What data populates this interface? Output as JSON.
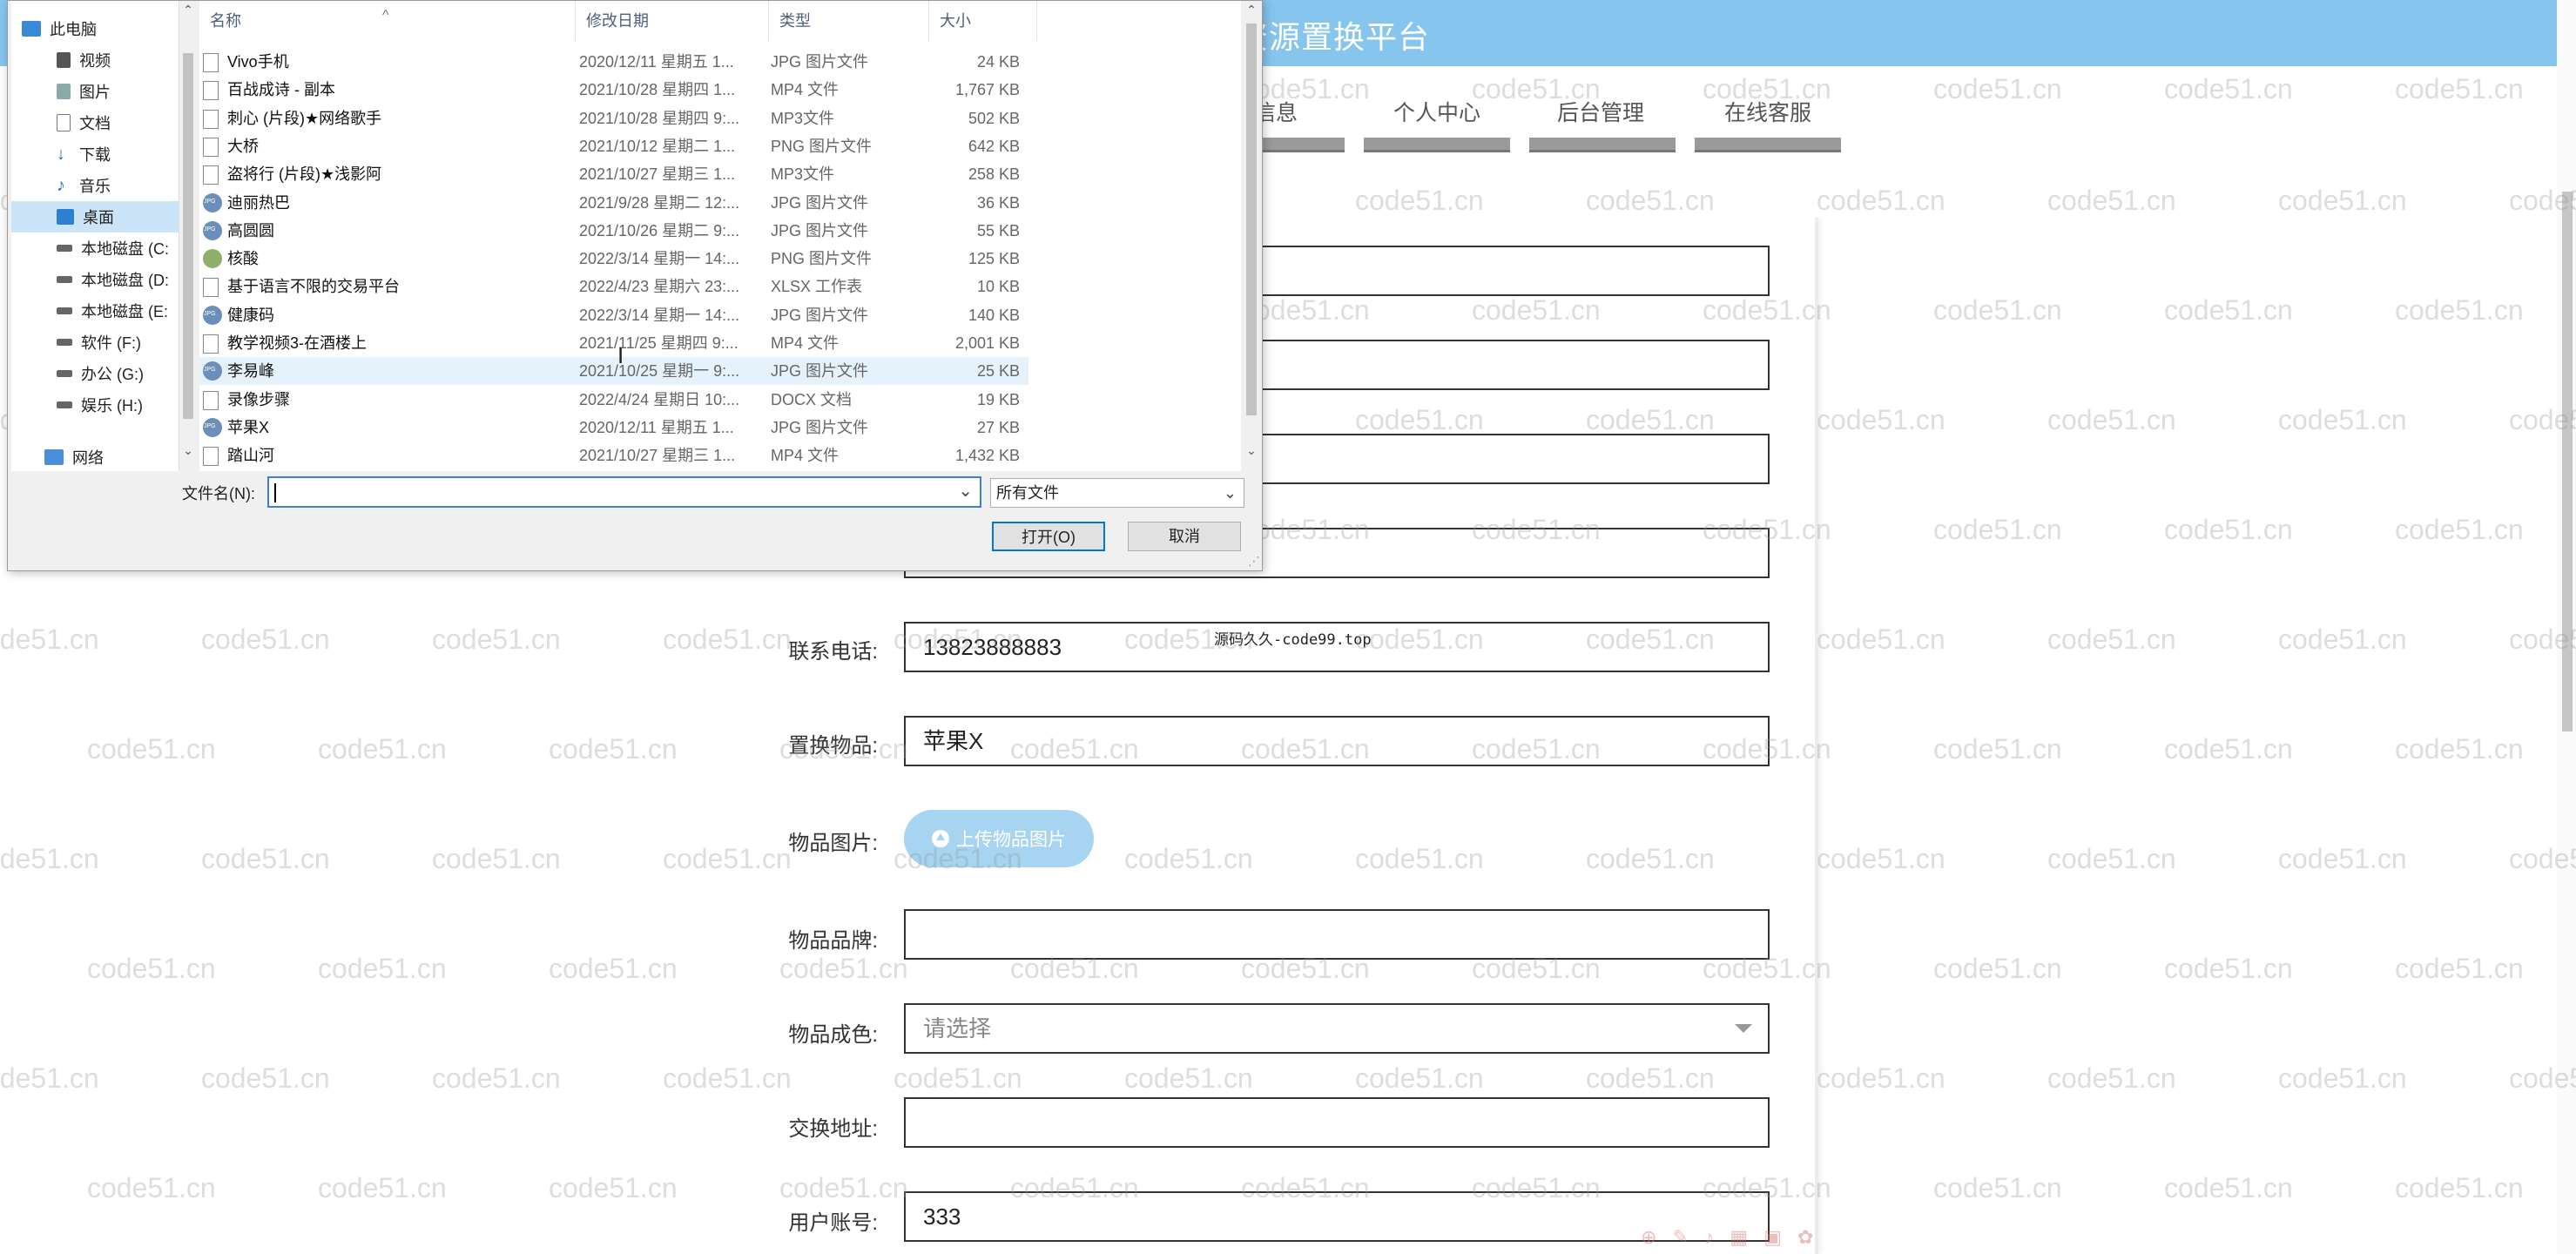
{
  "site": {
    "title": "资源置换平台",
    "nav": [
      "信息",
      "个人中心",
      "后台管理",
      "在线客服"
    ]
  },
  "form": {
    "fields": [
      {
        "label": "",
        "value": ""
      },
      {
        "label": "",
        "value": ""
      },
      {
        "label": "",
        "value": ""
      },
      {
        "label": "",
        "value": ""
      },
      {
        "label": "联系电话:",
        "value": "13823888883"
      },
      {
        "label": "置换物品:",
        "value": "苹果X"
      },
      {
        "label": "物品图片:",
        "value": ""
      },
      {
        "label": "物品品牌:",
        "value": ""
      },
      {
        "label": "物品成色:",
        "value": ""
      },
      {
        "label": "交换地址:",
        "value": ""
      },
      {
        "label": "用户账号:",
        "value": "333"
      }
    ],
    "upload_label": "上传物品图片",
    "condition_placeholder": "请选择",
    "overlay_note": "源码久久-code99.top"
  },
  "watermark_text": "code51.cn",
  "dialog": {
    "nav_items": [
      "此电脑",
      "视频",
      "图片",
      "文档",
      "下载",
      "音乐",
      "桌面",
      "本地磁盘 (C:",
      "本地磁盘 (D:",
      "本地磁盘 (E:",
      "软件 (F:)",
      "办公 (G:)",
      "娱乐 (H:)",
      "网络"
    ],
    "selected_nav": "桌面",
    "columns": [
      "名称",
      "修改日期",
      "类型",
      "大小"
    ],
    "files": [
      {
        "name": "Vivo手机",
        "date": "2020/12/11 星期五 1...",
        "type": "JPG 图片文件",
        "size": "24 KB",
        "icon": "doc"
      },
      {
        "name": "百战成诗 - 副本",
        "date": "2021/10/28 星期四 1...",
        "type": "MP4 文件",
        "size": "1,767 KB",
        "icon": "doc"
      },
      {
        "name": "刺心 (片段)★网络歌手",
        "date": "2021/10/28 星期四 9:...",
        "type": "MP3文件",
        "size": "502 KB",
        "icon": "doc"
      },
      {
        "name": "大桥",
        "date": "2021/10/12 星期二 1...",
        "type": "PNG 图片文件",
        "size": "642 KB",
        "icon": "doc"
      },
      {
        "name": "盗将行 (片段)★浅影阿",
        "date": "2021/10/27 星期三 1...",
        "type": "MP3文件",
        "size": "258 KB",
        "icon": "doc"
      },
      {
        "name": "迪丽热巴",
        "date": "2021/9/28 星期二 12:...",
        "type": "JPG 图片文件",
        "size": "36 KB",
        "icon": "img"
      },
      {
        "name": "高圆圆",
        "date": "2021/10/26 星期二 9:...",
        "type": "JPG 图片文件",
        "size": "55 KB",
        "icon": "img"
      },
      {
        "name": "核酸",
        "date": "2022/3/14 星期一 14:...",
        "type": "PNG 图片文件",
        "size": "125 KB",
        "icon": "png"
      },
      {
        "name": "基于语言不限的交易平台",
        "date": "2022/4/23 星期六 23:...",
        "type": "XLSX 工作表",
        "size": "10 KB",
        "icon": "doc"
      },
      {
        "name": "健康码",
        "date": "2022/3/14 星期一 14:...",
        "type": "JPG 图片文件",
        "size": "140 KB",
        "icon": "img"
      },
      {
        "name": "教学视频3-在酒楼上",
        "date": "2021/11/25 星期四 9:...",
        "type": "MP4 文件",
        "size": "2,001 KB",
        "icon": "doc"
      },
      {
        "name": "李易峰",
        "date": "2021/10/25 星期一 9:...",
        "type": "JPG 图片文件",
        "size": "25 KB",
        "icon": "img"
      },
      {
        "name": "录像步骤",
        "date": "2022/4/24 星期日 10:...",
        "type": "DOCX 文档",
        "size": "19 KB",
        "icon": "doc"
      },
      {
        "name": "苹果X",
        "date": "2020/12/11 星期五 1...",
        "type": "JPG 图片文件",
        "size": "27 KB",
        "icon": "img"
      },
      {
        "name": "踏山河",
        "date": "2021/10/27 星期三 1...",
        "type": "MP4 文件",
        "size": "1,432 KB",
        "icon": "doc"
      }
    ],
    "hover_row": "李易峰",
    "filename_label": "文件名(N):",
    "filename_value": "",
    "filter_value": "所有文件",
    "open_button": "打开(O)",
    "cancel_button": "取消"
  }
}
